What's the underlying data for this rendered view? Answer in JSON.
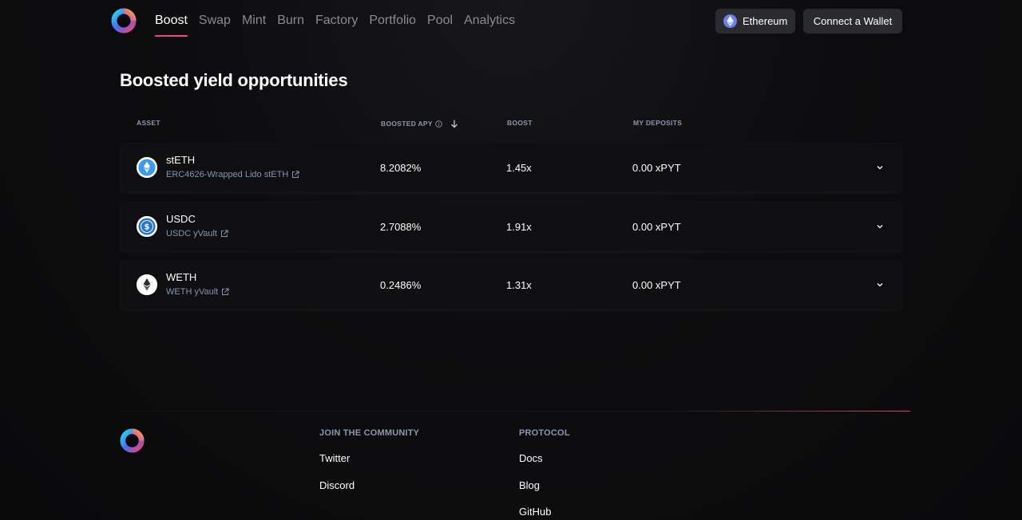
{
  "nav": {
    "items": [
      {
        "label": "Boost",
        "active": true
      },
      {
        "label": "Swap",
        "active": false
      },
      {
        "label": "Mint",
        "active": false
      },
      {
        "label": "Burn",
        "active": false
      },
      {
        "label": "Factory",
        "active": false
      },
      {
        "label": "Portfolio",
        "active": false
      },
      {
        "label": "Pool",
        "active": false
      },
      {
        "label": "Analytics",
        "active": false
      }
    ],
    "network_label": "Ethereum",
    "wallet_label": "Connect a Wallet"
  },
  "main": {
    "title": "Boosted yield opportunities",
    "columns": {
      "asset": "ASSET",
      "apy": "BOOSTED APY",
      "boost": "BOOST",
      "deposits": "MY DEPOSITS"
    },
    "sort": {
      "column": "apy",
      "direction": "desc"
    },
    "rows": [
      {
        "name": "stETH",
        "sub": "ERC4626-Wrapped Lido stETH",
        "apy": "8.2082%",
        "boost": "1.45x",
        "deposits": "0.00 xPYT",
        "icon": "steth-icon"
      },
      {
        "name": "USDC",
        "sub": "USDC yVault",
        "apy": "2.7088%",
        "boost": "1.91x",
        "deposits": "0.00 xPYT",
        "icon": "usdc-icon"
      },
      {
        "name": "WETH",
        "sub": "WETH yVault",
        "apy": "0.2486%",
        "boost": "1.31x",
        "deposits": "0.00 xPYT",
        "icon": "weth-icon"
      }
    ]
  },
  "footer": {
    "community": {
      "heading": "JOIN THE COMMUNITY",
      "links": [
        "Twitter",
        "Discord"
      ]
    },
    "protocol": {
      "heading": "PROTOCOL",
      "links": [
        "Docs",
        "Blog",
        "GitHub"
      ]
    }
  },
  "colors": {
    "accent": "#f0427a",
    "background": "#0b0b0c",
    "button_bg": "#2a2b2e",
    "muted_text": "#8b8c90",
    "link_text": "#8496b6"
  }
}
